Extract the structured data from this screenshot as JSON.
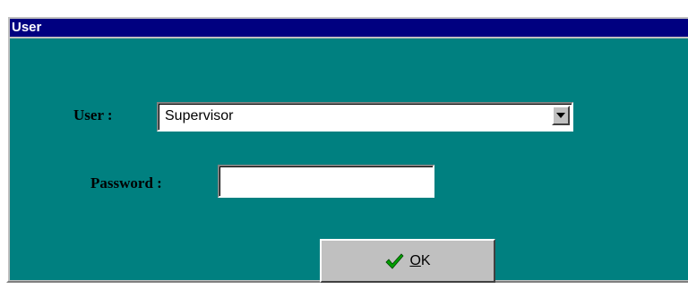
{
  "window": {
    "title": "User"
  },
  "form": {
    "user_label": "User :",
    "user_value": "Supervisor",
    "password_label": "Password :",
    "password_value": ""
  },
  "buttons": {
    "ok_mnemonic": "O",
    "ok_rest": "K"
  },
  "icons": {
    "ok": "check-icon",
    "dropdown": "chevron-down-icon"
  },
  "colors": {
    "titlebar": "#000080",
    "client": "#008080",
    "check": "#00a000"
  }
}
